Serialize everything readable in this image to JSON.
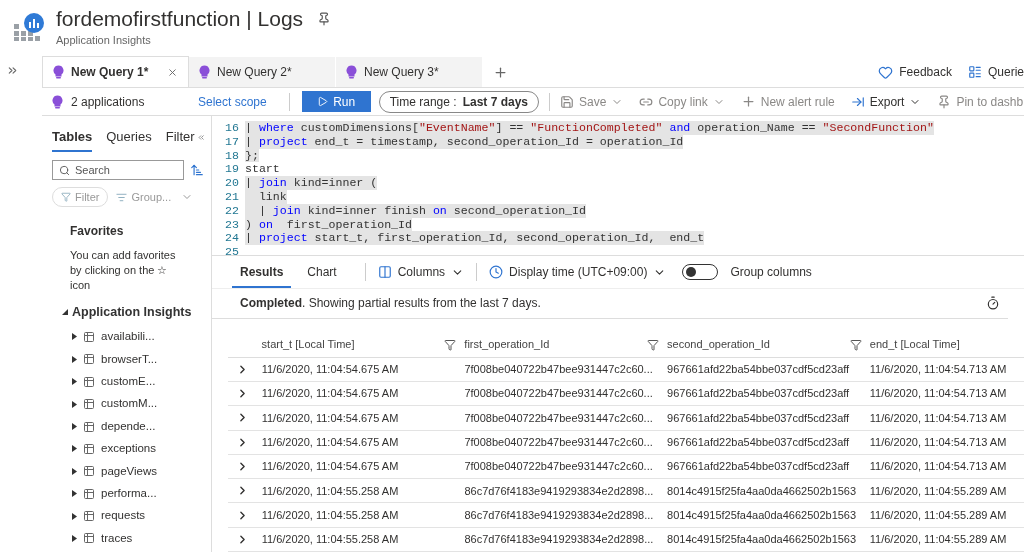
{
  "header": {
    "title": "fordemofirstfunction | Logs",
    "subtitle": "Application Insights"
  },
  "tabs": [
    {
      "label": "New Query 1*",
      "selected": true
    },
    {
      "label": "New Query 2*",
      "selected": false
    },
    {
      "label": "New Query 3*",
      "selected": false
    }
  ],
  "top_links": [
    "Feedback",
    "Querie"
  ],
  "toolbar": {
    "scope": "2 applications",
    "select_scope": "Select scope",
    "run": "Run",
    "time_range_label": "Time range :",
    "time_range_value": "Last 7 days",
    "actions": [
      {
        "kind": "save",
        "label": "Save",
        "dropdown": true,
        "disabled": true
      },
      {
        "kind": "link",
        "label": "Copy link",
        "dropdown": true,
        "disabled": true
      },
      {
        "kind": "alert",
        "label": "New alert rule",
        "dropdown": false,
        "disabled": true
      },
      {
        "kind": "export",
        "label": "Export",
        "dropdown": true,
        "disabled": false
      },
      {
        "kind": "pin",
        "label": "Pin to dashb",
        "dropdown": false,
        "disabled": true
      }
    ]
  },
  "sidebar": {
    "tabs": [
      {
        "label": "Tables",
        "selected": true
      },
      {
        "label": "Queries",
        "selected": false
      },
      {
        "label": "Filter",
        "selected": false
      }
    ],
    "search": {
      "placeholder": "Search"
    },
    "filter": "Filter",
    "group": "Group...",
    "favorites": {
      "title": "Favorites",
      "text": "You can add favorites by clicking on the ☆ icon"
    },
    "tree": {
      "label": "Application Insights",
      "expanded": true,
      "children": [
        {
          "label": "availabili...",
          "expanded": false
        },
        {
          "label": "browserT...",
          "expanded": false
        },
        {
          "label": "customE...",
          "expanded": false
        },
        {
          "label": "customM...",
          "expanded": false
        },
        {
          "label": "depende...",
          "expanded": false
        },
        {
          "label": "exceptions",
          "expanded": false
        },
        {
          "label": "pageViews",
          "expanded": false
        },
        {
          "label": "performa...",
          "expanded": false
        },
        {
          "label": "requests",
          "expanded": false
        },
        {
          "label": "traces",
          "expanded": false
        }
      ]
    }
  },
  "editor": {
    "lines": [
      {
        "number": "16",
        "highlighted": true,
        "segments": [
          {
            "kind": "plain",
            "text": "| "
          },
          {
            "kind": "keyword",
            "text": "where"
          },
          {
            "kind": "plain",
            "text": " customDimensions["
          },
          {
            "kind": "string",
            "text": "\"EventName\""
          },
          {
            "kind": "plain",
            "text": "] == "
          },
          {
            "kind": "string",
            "text": "\"FunctionCompleted\""
          },
          {
            "kind": "keyword",
            "text": " and"
          },
          {
            "kind": "plain",
            "text": " operation_Name == "
          },
          {
            "kind": "string",
            "text": "\"SecondFunction\""
          }
        ]
      },
      {
        "number": "17",
        "highlighted": true,
        "segments": [
          {
            "kind": "plain",
            "text": "| "
          },
          {
            "kind": "keyword",
            "text": "project"
          },
          {
            "kind": "plain",
            "text": " end_t = timestamp, second_operation_Id = operation_Id"
          }
        ]
      },
      {
        "number": "18",
        "highlighted": true,
        "segments": [
          {
            "kind": "plain",
            "text": "};"
          }
        ]
      },
      {
        "number": "19",
        "highlighted": false,
        "segments": [
          {
            "kind": "plain",
            "text": "start"
          }
        ]
      },
      {
        "number": "20",
        "highlighted": true,
        "segments": [
          {
            "kind": "plain",
            "text": "| "
          },
          {
            "kind": "keyword",
            "text": "join"
          },
          {
            "kind": "plain",
            "text": " kind=inner ("
          }
        ]
      },
      {
        "number": "21",
        "highlighted": true,
        "segments": [
          {
            "kind": "plain",
            "text": "  link"
          }
        ]
      },
      {
        "number": "22",
        "highlighted": true,
        "segments": [
          {
            "kind": "plain",
            "text": "  | "
          },
          {
            "kind": "keyword",
            "text": "join"
          },
          {
            "kind": "plain",
            "text": " kind=inner finish "
          },
          {
            "kind": "keyword",
            "text": "on"
          },
          {
            "kind": "plain",
            "text": " second_operation_Id"
          }
        ]
      },
      {
        "number": "23",
        "highlighted": true,
        "segments": [
          {
            "kind": "plain",
            "text": ") "
          },
          {
            "kind": "keyword",
            "text": "on"
          },
          {
            "kind": "plain",
            "text": "  first_operation_Id"
          }
        ]
      },
      {
        "number": "24",
        "highlighted": true,
        "segments": [
          {
            "kind": "plain",
            "text": "| "
          },
          {
            "kind": "keyword",
            "text": "project"
          },
          {
            "kind": "plain",
            "text": " start_t, first_operation_Id, second_operation_Id,  end_t"
          }
        ]
      },
      {
        "number": "25",
        "highlighted": false
      }
    ]
  },
  "results": {
    "tabs": [
      {
        "label": "Results",
        "selected": true
      },
      {
        "label": "Chart",
        "selected": false
      }
    ],
    "columns_button": "Columns",
    "display_time": "Display time (UTC+09:00)",
    "group_columns": {
      "label": "Group columns",
      "on": false
    },
    "status": "**Completed**. Showing partial results from the last 7 days.",
    "table": {
      "columns": [
        "start_t [Local Time]",
        "first_operation_Id",
        "second_operation_Id",
        "end_t [Local Time]"
      ],
      "rows": [
        [
          "11/6/2020, 11:04:54.675 AM",
          "7f008be040722b47bee931447c2c60...",
          "967661afd22ba54bbe037cdf5cd23aff",
          "11/6/2020, 11:04:54.713 AM"
        ],
        [
          "11/6/2020, 11:04:54.675 AM",
          "7f008be040722b47bee931447c2c60...",
          "967661afd22ba54bbe037cdf5cd23aff",
          "11/6/2020, 11:04:54.713 AM"
        ],
        [
          "11/6/2020, 11:04:54.675 AM",
          "7f008be040722b47bee931447c2c60...",
          "967661afd22ba54bbe037cdf5cd23aff",
          "11/6/2020, 11:04:54.713 AM"
        ],
        [
          "11/6/2020, 11:04:54.675 AM",
          "7f008be040722b47bee931447c2c60...",
          "967661afd22ba54bbe037cdf5cd23aff",
          "11/6/2020, 11:04:54.713 AM"
        ],
        [
          "11/6/2020, 11:04:54.675 AM",
          "7f008be040722b47bee931447c2c60...",
          "967661afd22ba54bbe037cdf5cd23aff",
          "11/6/2020, 11:04:54.713 AM"
        ],
        [
          "11/6/2020, 11:04:55.258 AM",
          "86c7d76f4183e9419293834e2d2898...",
          "8014c4915f25fa4aa0da4662502b1563",
          "11/6/2020, 11:04:55.289 AM"
        ],
        [
          "11/6/2020, 11:04:55.258 AM",
          "86c7d76f4183e9419293834e2d2898...",
          "8014c4915f25fa4aa0da4662502b1563",
          "11/6/2020, 11:04:55.289 AM"
        ],
        [
          "11/6/2020, 11:04:55.258 AM",
          "86c7d76f4183e9419293834e2d2898...",
          "8014c4915f25fa4aa0da4662502b1563",
          "11/6/2020, 11:04:55.289 AM"
        ]
      ]
    }
  }
}
